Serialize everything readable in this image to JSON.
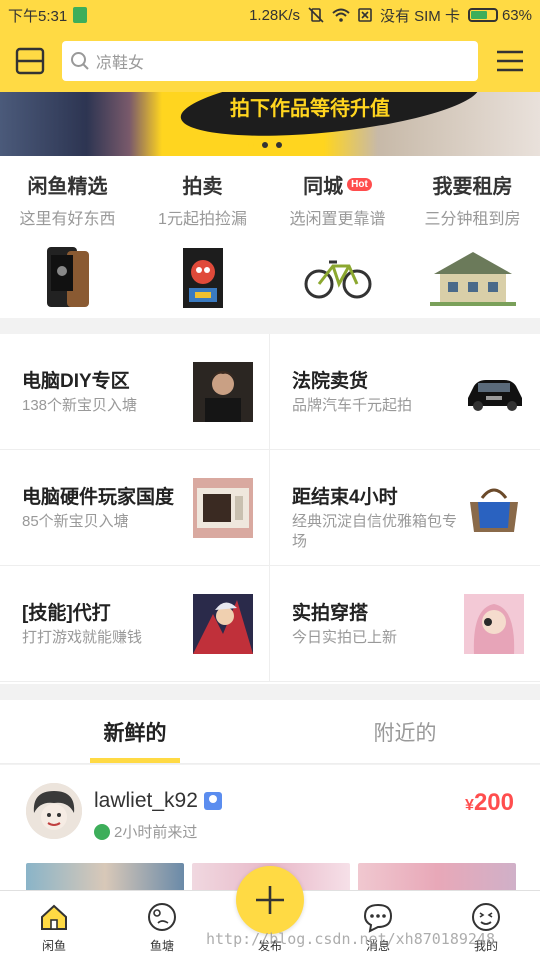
{
  "status_bar": {
    "time": "下午5:31",
    "speed": "1.28K/s",
    "carrier": "没有 SIM 卡",
    "battery": "63%"
  },
  "search": {
    "placeholder": "凉鞋女"
  },
  "banner": {
    "slogan": "拍下作品等待升值",
    "slides": 3,
    "active_slide": 1
  },
  "features": [
    {
      "title": "闲鱼精选",
      "subtitle": "这里有好东西",
      "icon": "phone-image"
    },
    {
      "title": "拍卖",
      "subtitle": "1元起拍捡漏",
      "icon": "painting-image"
    },
    {
      "title": "同城",
      "subtitle": "选闲置更靠谱",
      "badge": "Hot",
      "icon": "bicycle-image"
    },
    {
      "title": "我要租房",
      "subtitle": "三分钟租到房",
      "icon": "house-image"
    }
  ],
  "ponds": [
    {
      "title": "电脑DIY专区",
      "subtitle": "138个新宝贝入塘",
      "icon": "person-photo"
    },
    {
      "title": "法院卖货",
      "subtitle": "品牌汽车千元起拍",
      "icon": "car-image"
    },
    {
      "title": "电脑硬件玩家国度",
      "subtitle": "85个新宝贝入塘",
      "icon": "hardware-photo"
    },
    {
      "title": "距结束4小时",
      "subtitle": "经典沉淀自信优雅箱包专场",
      "icon": "handbag-image"
    },
    {
      "title": "[技能]代打",
      "subtitle": "打打游戏就能赚钱",
      "icon": "game-art"
    },
    {
      "title": "实拍穿搭",
      "subtitle": "今日实拍已上新",
      "icon": "girl-photo"
    }
  ],
  "tabs": [
    {
      "label": "新鲜的",
      "active": true
    },
    {
      "label": "附近的",
      "active": false
    }
  ],
  "feed_item": {
    "username": "lawliet_k92",
    "time": "2小时前来过",
    "price_symbol": "¥",
    "price": "200"
  },
  "bottom_nav": [
    {
      "label": "闲鱼",
      "icon": "home-icon"
    },
    {
      "label": "鱼塘",
      "icon": "pond-icon"
    },
    {
      "label": "发布",
      "icon": "plus-icon"
    },
    {
      "label": "消息",
      "icon": "message-icon"
    },
    {
      "label": "我的",
      "icon": "profile-icon"
    }
  ],
  "watermark": "http://blog.csdn.net/xh870189248",
  "colors": {
    "brand": "#ffda44",
    "price": "#ff4e4e",
    "hot": "#ff4d4d"
  }
}
